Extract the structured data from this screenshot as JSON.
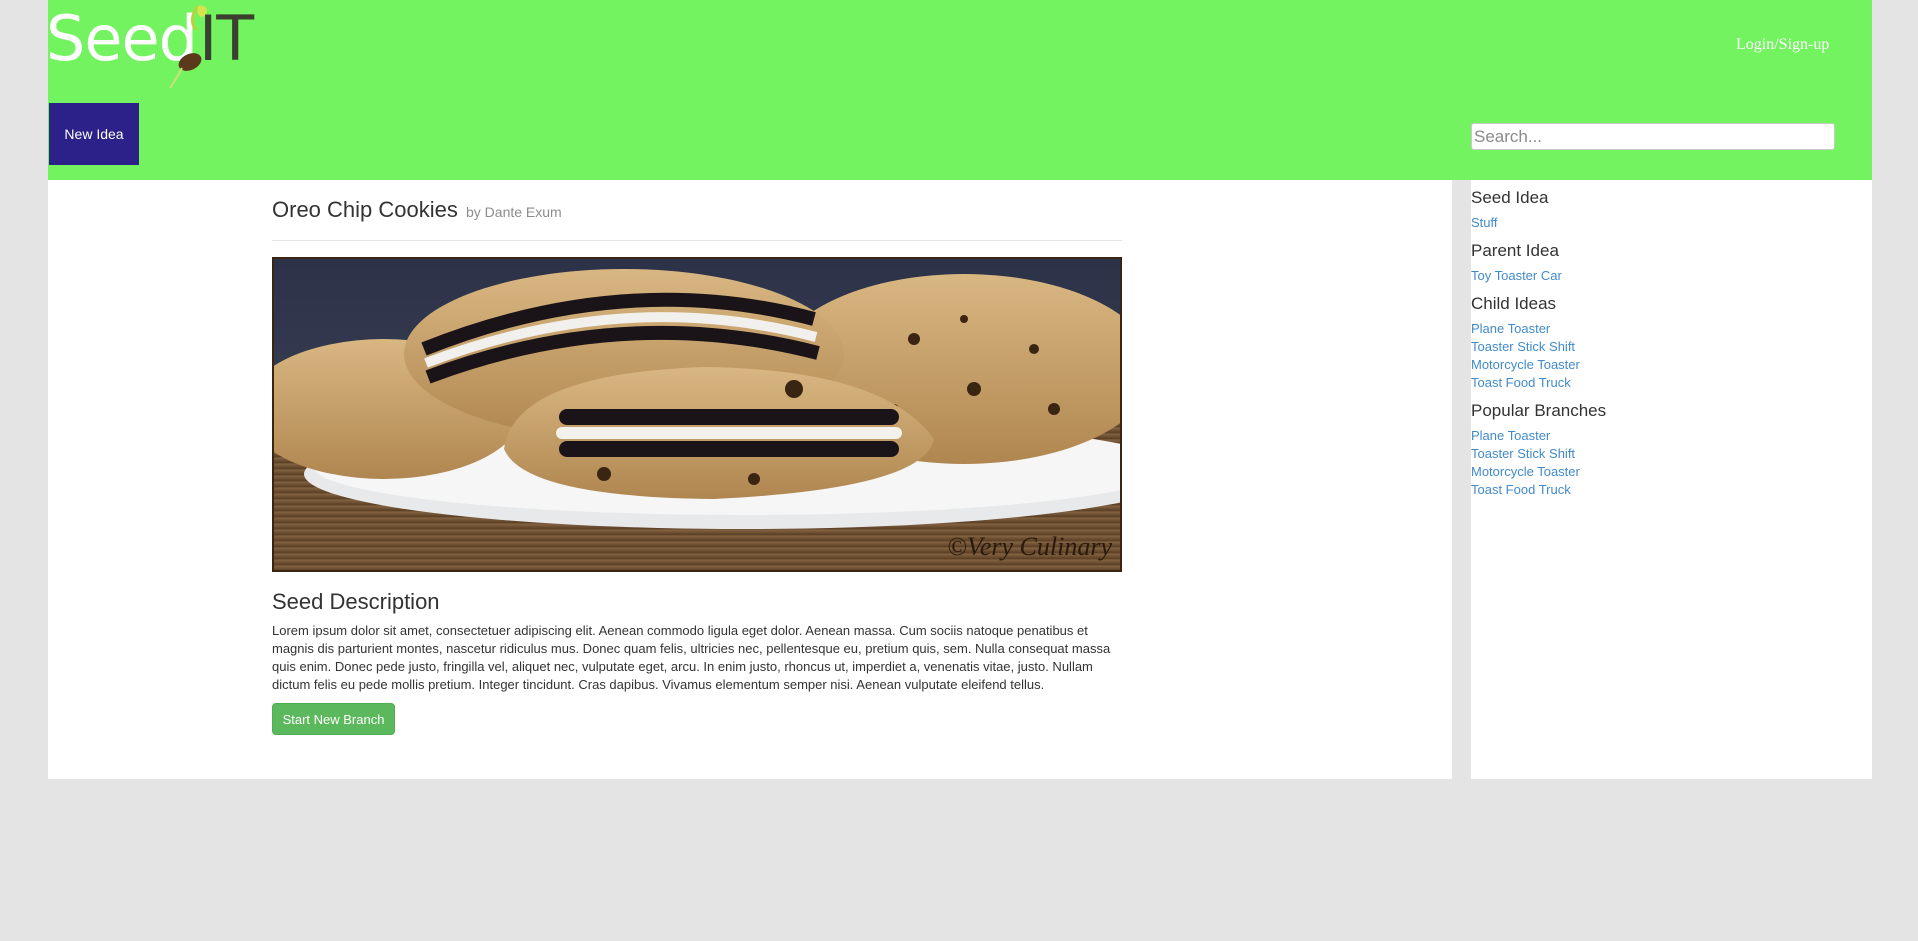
{
  "header": {
    "logo_text_primary": "Seed",
    "logo_text_secondary": "IT",
    "login_label": "Login/Sign-up",
    "new_idea_label": "New Idea",
    "search_placeholder": "Search..."
  },
  "post": {
    "title": "Oreo Chip Cookies",
    "author": "by Dante Exum",
    "image_watermark": "©Very Culinary",
    "description_heading": "Seed Description",
    "description": "Lorem ipsum dolor sit amet, consectetuer adipiscing elit. Aenean commodo ligula eget dolor. Aenean massa. Cum sociis natoque penatibus et magnis dis parturient montes, nascetur ridiculus mus. Donec quam felis, ultricies nec, pellentesque eu, pretium quis, sem. Nulla consequat massa quis enim. Donec pede justo, fringilla vel, aliquet nec, vulputate eget, arcu. In enim justo, rhoncus ut, imperdiet a, venenatis vitae, justo. Nullam dictum felis eu pede mollis pretium. Integer tincidunt. Cras dapibus. Vivamus elementum semper nisi. Aenean vulputate eleifend tellus.",
    "branch_button_label": "Start New Branch"
  },
  "sidebar": {
    "seed_idea": {
      "heading": "Seed Idea",
      "links": [
        "Stuff"
      ]
    },
    "parent_idea": {
      "heading": "Parent Idea",
      "links": [
        "Toy Toaster Car"
      ]
    },
    "child_ideas": {
      "heading": "Child Ideas",
      "links": [
        "Plane Toaster",
        "Toaster Stick Shift",
        "Motorcycle Toaster",
        "Toast Food Truck"
      ]
    },
    "popular_branches": {
      "heading": "Popular Branches",
      "links": [
        "Plane Toaster",
        "Toaster Stick Shift",
        "Motorcycle Toaster",
        "Toast Food Truck"
      ]
    }
  },
  "colors": {
    "header_bg": "#72f35f",
    "new_idea_bg": "#2b2188",
    "branch_button_bg": "#5cb85c",
    "link": "#428bca",
    "page_bg": "#e4e4e4"
  }
}
